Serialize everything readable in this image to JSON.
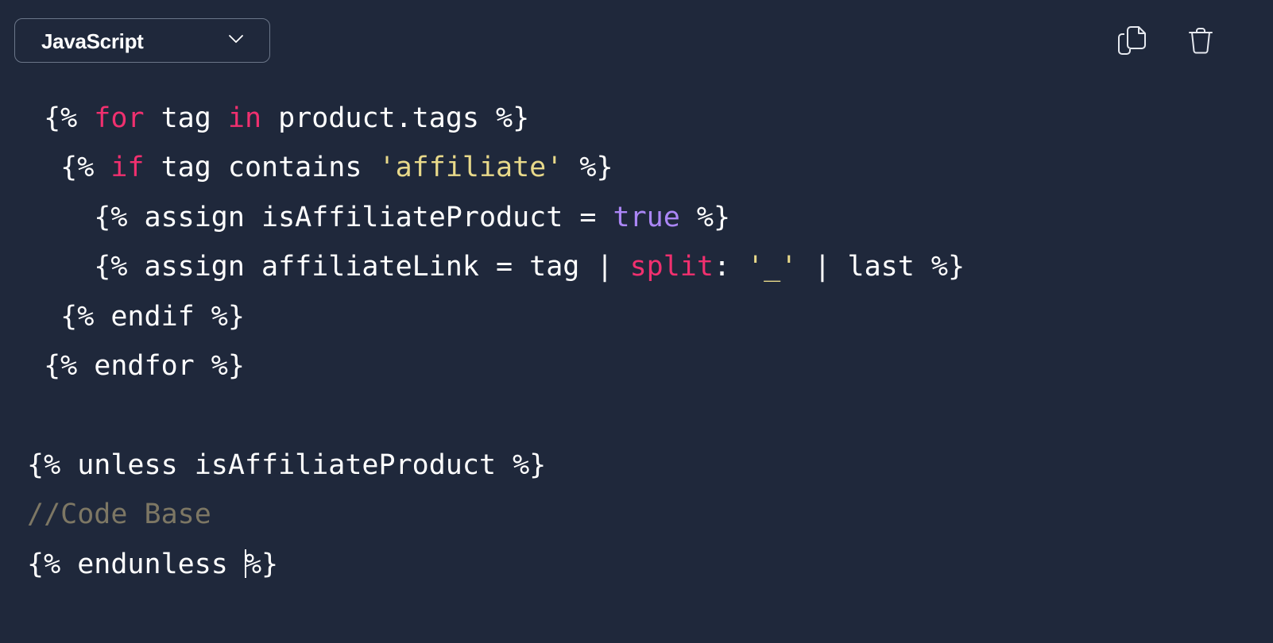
{
  "toolbar": {
    "language_label": "JavaScript",
    "language_dropdown_icon": "chevron-down-icon",
    "copy_icon": "copy-icon",
    "delete_icon": "trash-icon"
  },
  "colors": {
    "background": "#1f283b",
    "text": "#ffffff",
    "keyword": "#f0306f",
    "string": "#e8d98a",
    "boolean": "#ab86f6",
    "comment": "#7d7764",
    "border": "#6b7689"
  },
  "code": {
    "cursor_line": 10,
    "lines": [
      [
        {
          "t": " {% ",
          "c": ""
        },
        {
          "t": "for",
          "c": "kw"
        },
        {
          "t": " tag ",
          "c": ""
        },
        {
          "t": "in",
          "c": "kw"
        },
        {
          "t": " product.tags %}",
          "c": ""
        }
      ],
      [
        {
          "t": "  {% ",
          "c": ""
        },
        {
          "t": "if",
          "c": "kw"
        },
        {
          "t": " tag contains ",
          "c": ""
        },
        {
          "t": "'affiliate'",
          "c": "str"
        },
        {
          "t": " %}",
          "c": ""
        }
      ],
      [
        {
          "t": "    {% assign isAffiliateProduct = ",
          "c": ""
        },
        {
          "t": "true",
          "c": "bool"
        },
        {
          "t": " %}",
          "c": ""
        }
      ],
      [
        {
          "t": "    {% assign affiliateLink = tag | ",
          "c": ""
        },
        {
          "t": "split",
          "c": "kw"
        },
        {
          "t": ": ",
          "c": ""
        },
        {
          "t": "'_'",
          "c": "str"
        },
        {
          "t": " | last %}",
          "c": ""
        }
      ],
      [
        {
          "t": "  {% endif %}",
          "c": ""
        }
      ],
      [
        {
          "t": " {% endfor %}",
          "c": ""
        }
      ],
      [],
      [
        {
          "t": "{% unless isAffiliateProduct %}",
          "c": ""
        }
      ],
      [
        {
          "t": "//Code Base",
          "c": "cmt"
        }
      ],
      [
        {
          "t": "{% endunless ",
          "c": ""
        },
        {
          "t": "%}",
          "c": "",
          "cursor_before": true
        }
      ]
    ]
  }
}
